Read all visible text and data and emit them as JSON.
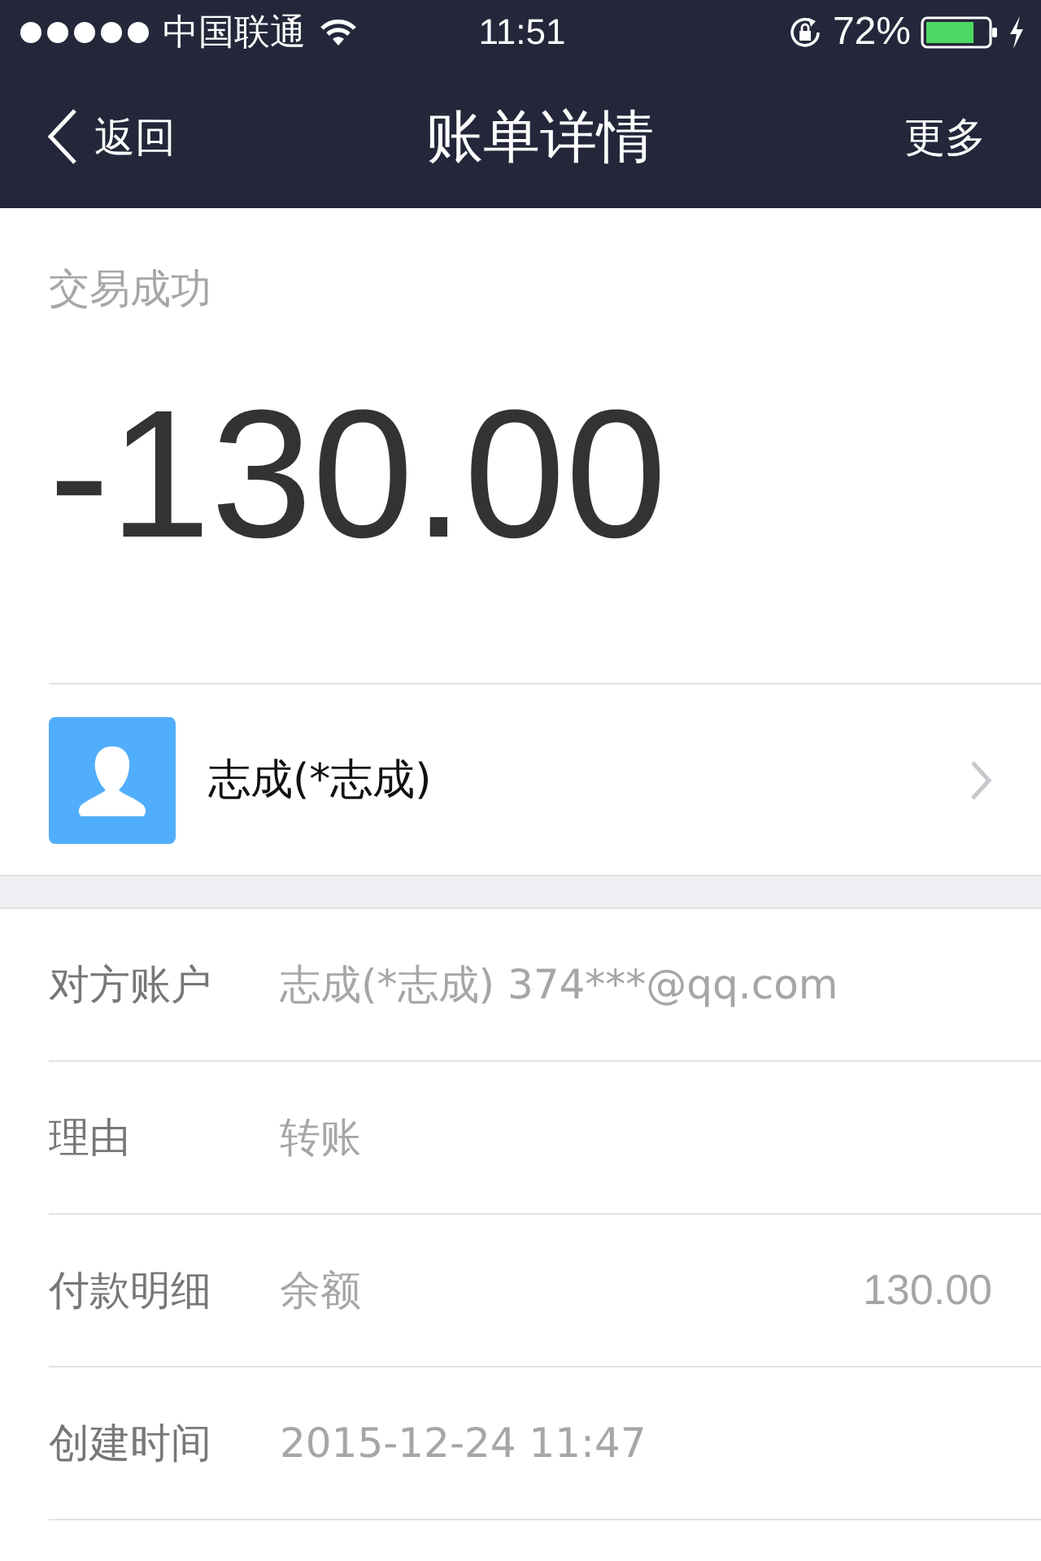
{
  "status_bar": {
    "carrier": "中国联通",
    "time": "11:51",
    "battery": "72%"
  },
  "nav": {
    "back": "返回",
    "title": "账单详情",
    "more": "更多"
  },
  "transaction": {
    "status": "交易成功",
    "amount": "-130.00"
  },
  "contact": {
    "name": "志成(*志成)"
  },
  "details": [
    {
      "label": "对方账户",
      "value": "志成(*志成) 374***@qq.com"
    },
    {
      "label": "理由",
      "value": "转账"
    },
    {
      "label": "付款明细",
      "value": "余额",
      "amount": "130.00"
    },
    {
      "label": "创建时间",
      "value": "2015-12-24 11:47"
    }
  ]
}
